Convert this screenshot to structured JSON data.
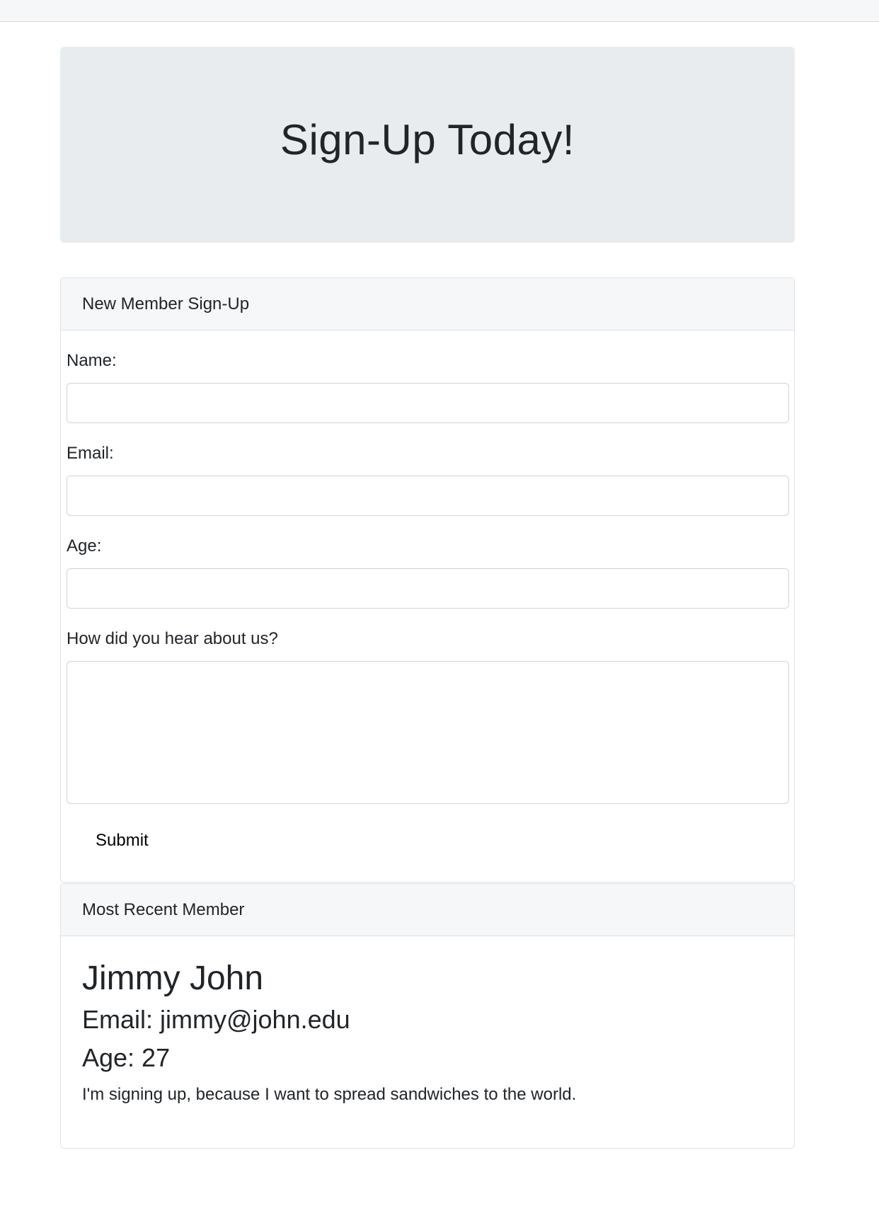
{
  "page": {
    "heading": "Sign-Up Today!"
  },
  "signup_card": {
    "header": "New Member Sign-Up",
    "fields": {
      "name_label": "Name:",
      "name_value": "",
      "email_label": "Email:",
      "email_value": "",
      "age_label": "Age:",
      "age_value": "",
      "reason_label": "How did you hear about us?",
      "reason_value": ""
    },
    "submit_label": "Submit"
  },
  "recent_card": {
    "header": "Most Recent Member",
    "name": "Jimmy John",
    "email": "Email: jimmy@john.edu",
    "age": "Age: 27",
    "reason": "I'm signing up, because I want to spread sandwiches to the world."
  },
  "colors": {
    "jumbotron_bg": "#e9ecef",
    "card_header_bg": "#f6f7f8",
    "border": "#dcdfe3",
    "text": "#212529"
  }
}
